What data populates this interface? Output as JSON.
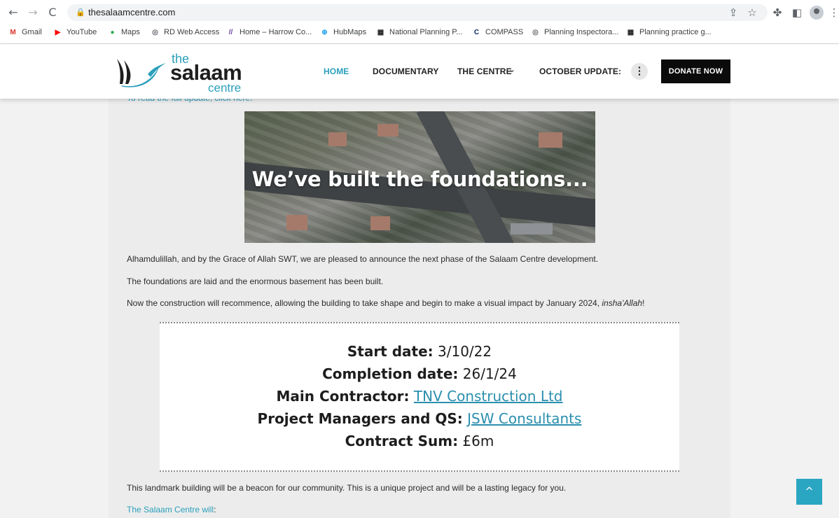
{
  "browser": {
    "url": "thesalaamcentre.com",
    "nav": {
      "back": "←",
      "forward": "→",
      "reload": "C"
    },
    "bookmarks": [
      {
        "label": "Gmail",
        "icon": "gmail-icon",
        "glyph": "M",
        "color": "#d93025"
      },
      {
        "label": "YouTube",
        "icon": "youtube-icon",
        "glyph": "▶",
        "color": "#ff0000"
      },
      {
        "label": "Maps",
        "icon": "maps-pin-icon",
        "glyph": "●",
        "color": "#34a853"
      },
      {
        "label": "RD Web Access",
        "icon": "globe-icon",
        "glyph": "◎",
        "color": "#5f6368"
      },
      {
        "label": "Home – Harrow Co...",
        "icon": "harrow-logo-icon",
        "glyph": "//",
        "color": "#6a3fa0"
      },
      {
        "label": "HubMaps",
        "icon": "hubmaps-icon",
        "glyph": "⊕",
        "color": "#1da1f2"
      },
      {
        "label": "National Planning P...",
        "icon": "gov-crest-icon",
        "glyph": "▦",
        "color": "#222222"
      },
      {
        "label": "COMPASS",
        "icon": "compass-icon",
        "glyph": "C",
        "color": "#0b2e6b"
      },
      {
        "label": "Planning Inspectora...",
        "icon": "globe-icon",
        "glyph": "◎",
        "color": "#5f6368"
      },
      {
        "label": "Planning practice g...",
        "icon": "gov-crest-icon",
        "glyph": "▦",
        "color": "#222222"
      }
    ]
  },
  "site": {
    "logo": {
      "the": "the",
      "salaam": "salaam",
      "centre": "centre"
    },
    "menu": [
      "HOME",
      "DOCUMENTARY",
      "THE CENTRE",
      "OCTOBER UPDATE:"
    ],
    "menu_caret": "⌄",
    "kebab": "⋮",
    "donate": "DONATE NOW"
  },
  "content": {
    "cut_text": "To read the full update, click here.",
    "hero_title": "We’ve built the foundations...",
    "p1": "Alhamdulillah, and by the Grace of Allah SWT, we are pleased to announce the next phase of the Salaam Centre development.",
    "p2": "The foundations are laid and the enormous basement has been built.",
    "p3_before": "Now the construction will recommence, allowing the building to take shape and begin to make a visual impact by January 2024, ",
    "p3_em": "insha'Allah",
    "p3_after": "!",
    "info": {
      "start_label": "Start date:",
      "start_value": "3/10/22",
      "completion_label": "Completion date:",
      "completion_value": "26/1/24",
      "contractor_label": "Main Contractor:",
      "contractor_value": "TNV Construction Ltd",
      "pm_label": "Project Managers and QS:",
      "pm_value": "JSW Consultants",
      "sum_label": "Contract Sum:",
      "sum_value": "£6m"
    },
    "p4": "This landmark building will be a beacon for our community. This is a unique project and will be a lasting legacy for you.",
    "p5_link": "The Salaam Centre will",
    "p5_after": ":",
    "to_top": "^"
  }
}
